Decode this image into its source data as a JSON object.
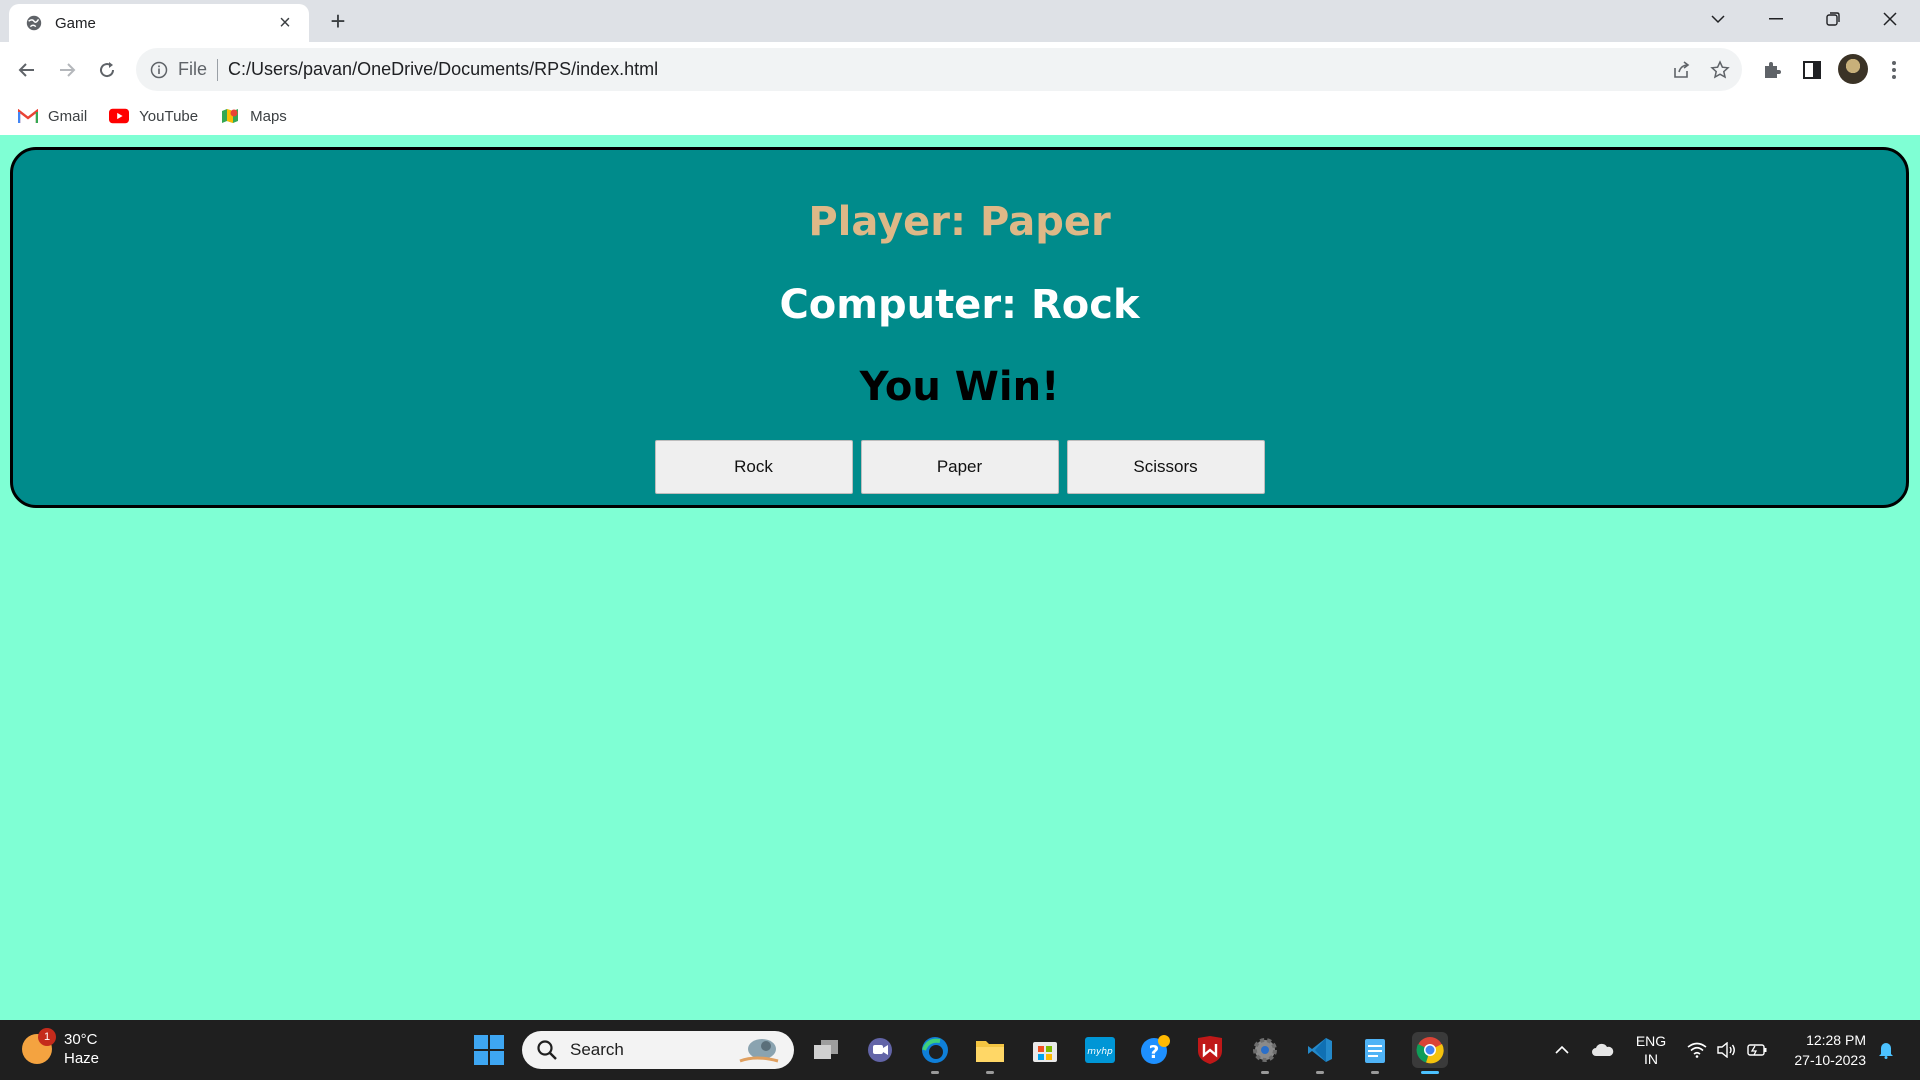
{
  "browser": {
    "tab_title": "Game",
    "tab_close": "×",
    "new_tab": "+",
    "omnibox_scheme": "File",
    "url": "C:/Users/pavan/OneDrive/Documents/RPS/index.html",
    "bookmarks": [
      {
        "label": "Gmail",
        "icon": "gmail-icon"
      },
      {
        "label": "YouTube",
        "icon": "youtube-icon"
      },
      {
        "label": "Maps",
        "icon": "maps-icon"
      }
    ]
  },
  "game": {
    "player_text": "Player: Paper",
    "computer_text": "Computer: Rock",
    "result_text": "You Win!",
    "buttons": [
      "Rock",
      "Paper",
      "Scissors"
    ],
    "colors": {
      "page_background": "#7fffd4",
      "panel_background": "#008b8b",
      "player_color": "#deb887",
      "computer_color": "#ffffff",
      "result_color": "#000000"
    }
  },
  "taskbar": {
    "weather_temp": "30°C",
    "weather_desc": "Haze",
    "weather_badge": "1",
    "search_placeholder": "Search",
    "lang_line1": "ENG",
    "lang_line2": "IN",
    "time": "12:28 PM",
    "date": "27-10-2023"
  }
}
